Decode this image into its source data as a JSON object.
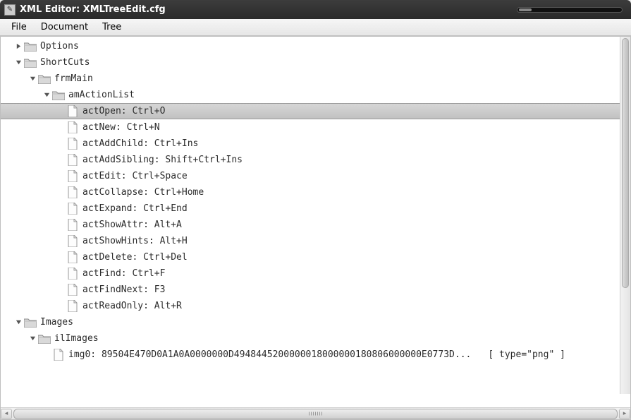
{
  "window": {
    "title": "XML Editor: XMLTreeEdit.cfg"
  },
  "menu": {
    "file": "File",
    "document": "Document",
    "tree": "Tree"
  },
  "tree": {
    "options": {
      "label": "Options",
      "expanded": false
    },
    "shortcuts": {
      "label": "ShortCuts",
      "expanded": true,
      "frmMain": {
        "label": "frmMain",
        "expanded": true,
        "amActionList": {
          "label": "amActionList",
          "expanded": true,
          "items": [
            {
              "label": "actOpen: Ctrl+O",
              "selected": true
            },
            {
              "label": "actNew: Ctrl+N"
            },
            {
              "label": "actAddChild: Ctrl+Ins"
            },
            {
              "label": "actAddSibling: Shift+Ctrl+Ins"
            },
            {
              "label": "actEdit: Ctrl+Space"
            },
            {
              "label": "actCollapse: Ctrl+Home"
            },
            {
              "label": "actExpand: Ctrl+End"
            },
            {
              "label": "actShowAttr: Alt+A"
            },
            {
              "label": "actShowHints: Alt+H"
            },
            {
              "label": "actDelete: Ctrl+Del"
            },
            {
              "label": "actFind: Ctrl+F"
            },
            {
              "label": "actFindNext: F3"
            },
            {
              "label": "actReadOnly: Alt+R"
            }
          ]
        }
      }
    },
    "images": {
      "label": "Images",
      "expanded": true,
      "ilImages": {
        "label": "ilImages",
        "expanded": true,
        "items": [
          {
            "label": "img0: 89504E470D0A1A0A0000000D4948445200000018000000180806000000E0773D...",
            "attrs": "[ type=\"png\" ]"
          }
        ]
      }
    }
  }
}
